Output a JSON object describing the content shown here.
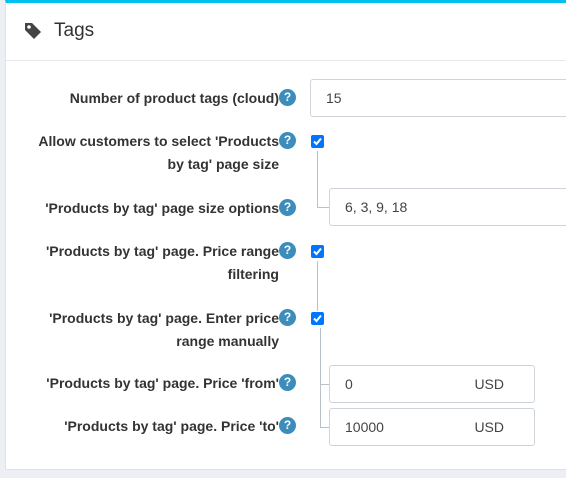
{
  "card": {
    "title": "Tags",
    "icon": "tag-icon"
  },
  "fields": {
    "number_of_tags": {
      "label": "Number of product tags (cloud)",
      "value": "15"
    },
    "allow_page_size": {
      "label_line1": "Allow customers to select 'Products",
      "label_line2": "by tag' page size",
      "checked": true
    },
    "page_size_options": {
      "label": "'Products by tag' page size options",
      "value": "6, 3, 9, 18"
    },
    "price_range_filtering": {
      "label_line1": "'Products by tag' page. Price range",
      "label_line2": "filtering",
      "checked": true
    },
    "enter_price_manually": {
      "label_line1": "'Products by tag' page. Enter price",
      "label_line2": "range manually",
      "checked": true
    },
    "price_from": {
      "label": "'Products by tag' page. Price 'from'",
      "value": "0",
      "unit": "USD"
    },
    "price_to": {
      "label": "'Products by tag' page. Price 'to'",
      "value": "10000",
      "unit": "USD"
    }
  },
  "help_glyph": "?",
  "colors": {
    "accent": "#00c0ef",
    "help": "#3c8dbc",
    "checkbox": "#0075ff"
  }
}
